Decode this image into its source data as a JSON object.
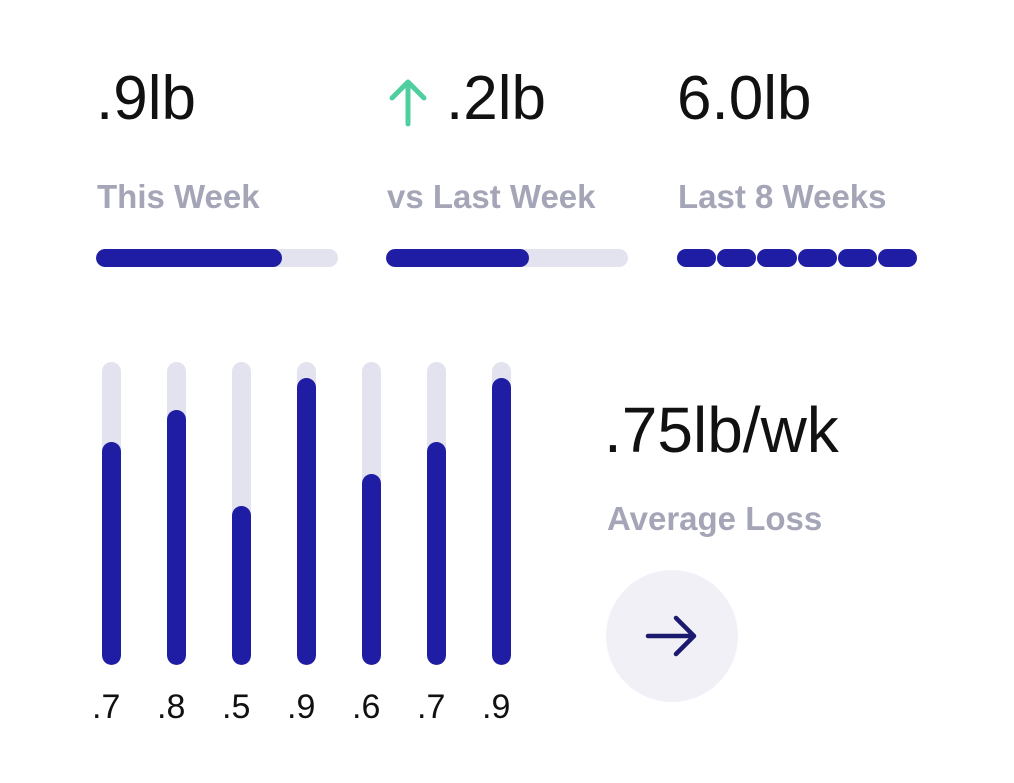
{
  "stats": [
    {
      "value": ".9lb",
      "label": "This Week",
      "progress": 0.77
    },
    {
      "value": ".2lb",
      "label": "vs Last Week",
      "progress": 0.59,
      "trend": "up",
      "trend_icon": "arrow-up-icon",
      "trend_color": "#4fcfa0"
    },
    {
      "value": "6.0lb",
      "label": "Last 8 Weeks",
      "segments_filled": 6,
      "segments_total": 6
    }
  ],
  "chart_data": {
    "type": "bar",
    "categories": [
      ".7",
      ".8",
      ".5",
      ".9",
      ".6",
      ".7",
      ".9"
    ],
    "values": [
      0.7,
      0.8,
      0.5,
      0.9,
      0.6,
      0.7,
      0.9
    ],
    "title": "",
    "xlabel": "",
    "ylabel": "",
    "ylim": [
      0,
      0.95
    ]
  },
  "average": {
    "value": ".75lb/wk",
    "label": "Average Loss"
  },
  "next_button": {
    "icon": "arrow-right-icon"
  },
  "colors": {
    "accent": "#1f1da4",
    "track": "#e2e3ee",
    "label": "#a4a6b7",
    "trend_up": "#4fcfa0",
    "button_bg": "#f1f0f7"
  }
}
